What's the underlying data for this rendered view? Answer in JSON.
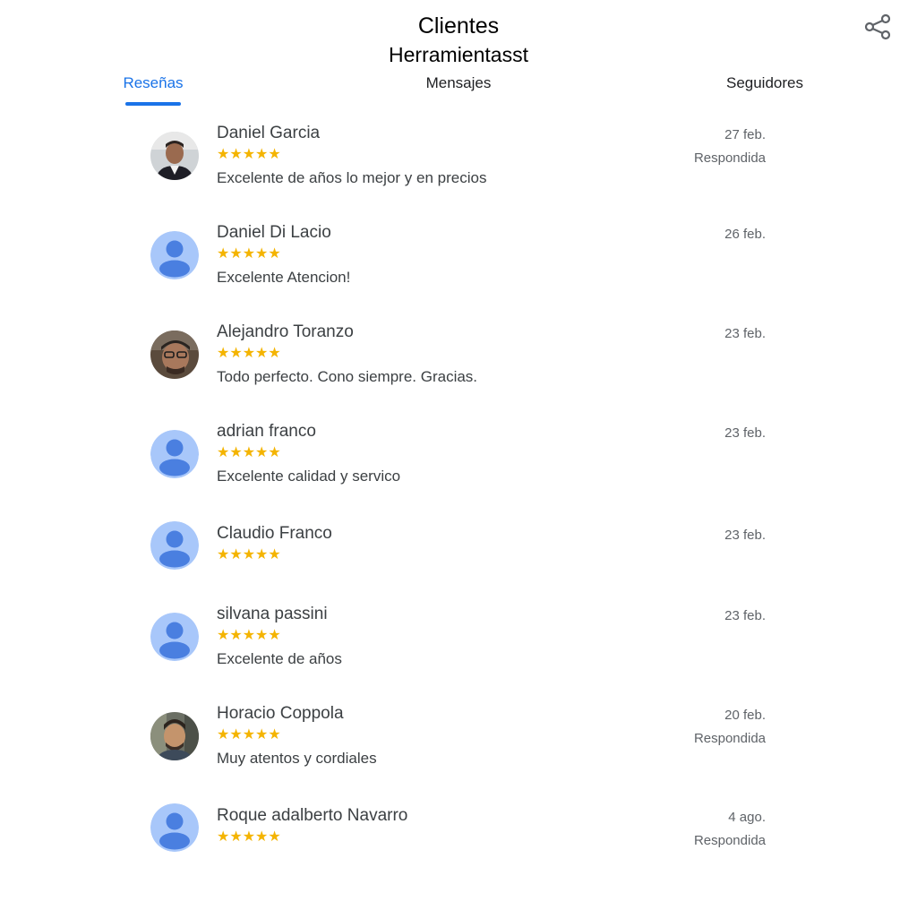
{
  "header": {
    "title": "Clientes",
    "subtitle": "Herramientasst",
    "share_icon": "share-icon"
  },
  "tabs": [
    {
      "label": "Reseñas",
      "active": true
    },
    {
      "label": "Mensajes",
      "active": false
    },
    {
      "label": "Seguidores",
      "active": false
    }
  ],
  "colors": {
    "accent": "#1a73e8",
    "star": "#f4b400",
    "avatar_bg": "#a8c7fa",
    "avatar_fg": "#4a7fe0"
  },
  "reviews": [
    {
      "name": "Daniel Garcia",
      "rating": 5,
      "stars": "★★★★★",
      "comment": "Excelente de años lo mejor y en precios",
      "date": "27 feb.",
      "status": "Respondida",
      "avatar": "photo"
    },
    {
      "name": "Daniel Di Lacio",
      "rating": 5,
      "stars": "★★★★★",
      "comment": "Excelente Atencion!",
      "date": "26 feb.",
      "status": "",
      "avatar": "default"
    },
    {
      "name": "Alejandro Toranzo",
      "rating": 5,
      "stars": "★★★★★",
      "comment": "Todo perfecto. Cono siempre. Gracias.",
      "date": "23 feb.",
      "status": "",
      "avatar": "photo"
    },
    {
      "name": "adrian franco",
      "rating": 5,
      "stars": "★★★★★",
      "comment": "Excelente calidad y servico",
      "date": "23 feb.",
      "status": "",
      "avatar": "default"
    },
    {
      "name": "Claudio Franco",
      "rating": 5,
      "stars": "★★★★★",
      "comment": "",
      "date": "23 feb.",
      "status": "",
      "avatar": "default"
    },
    {
      "name": "silvana passini",
      "rating": 5,
      "stars": "★★★★★",
      "comment": "Excelente de años",
      "date": "23 feb.",
      "status": "",
      "avatar": "default"
    },
    {
      "name": "Horacio Coppola",
      "rating": 5,
      "stars": "★★★★★",
      "comment": "Muy atentos y cordiales",
      "date": "20 feb.",
      "status": "Respondida",
      "avatar": "photo"
    },
    {
      "name": "Roque adalberto Navarro",
      "rating": 5,
      "stars": "★★★★★",
      "comment": "",
      "date": "4 ago.",
      "status": "Respondida",
      "avatar": "default"
    }
  ]
}
